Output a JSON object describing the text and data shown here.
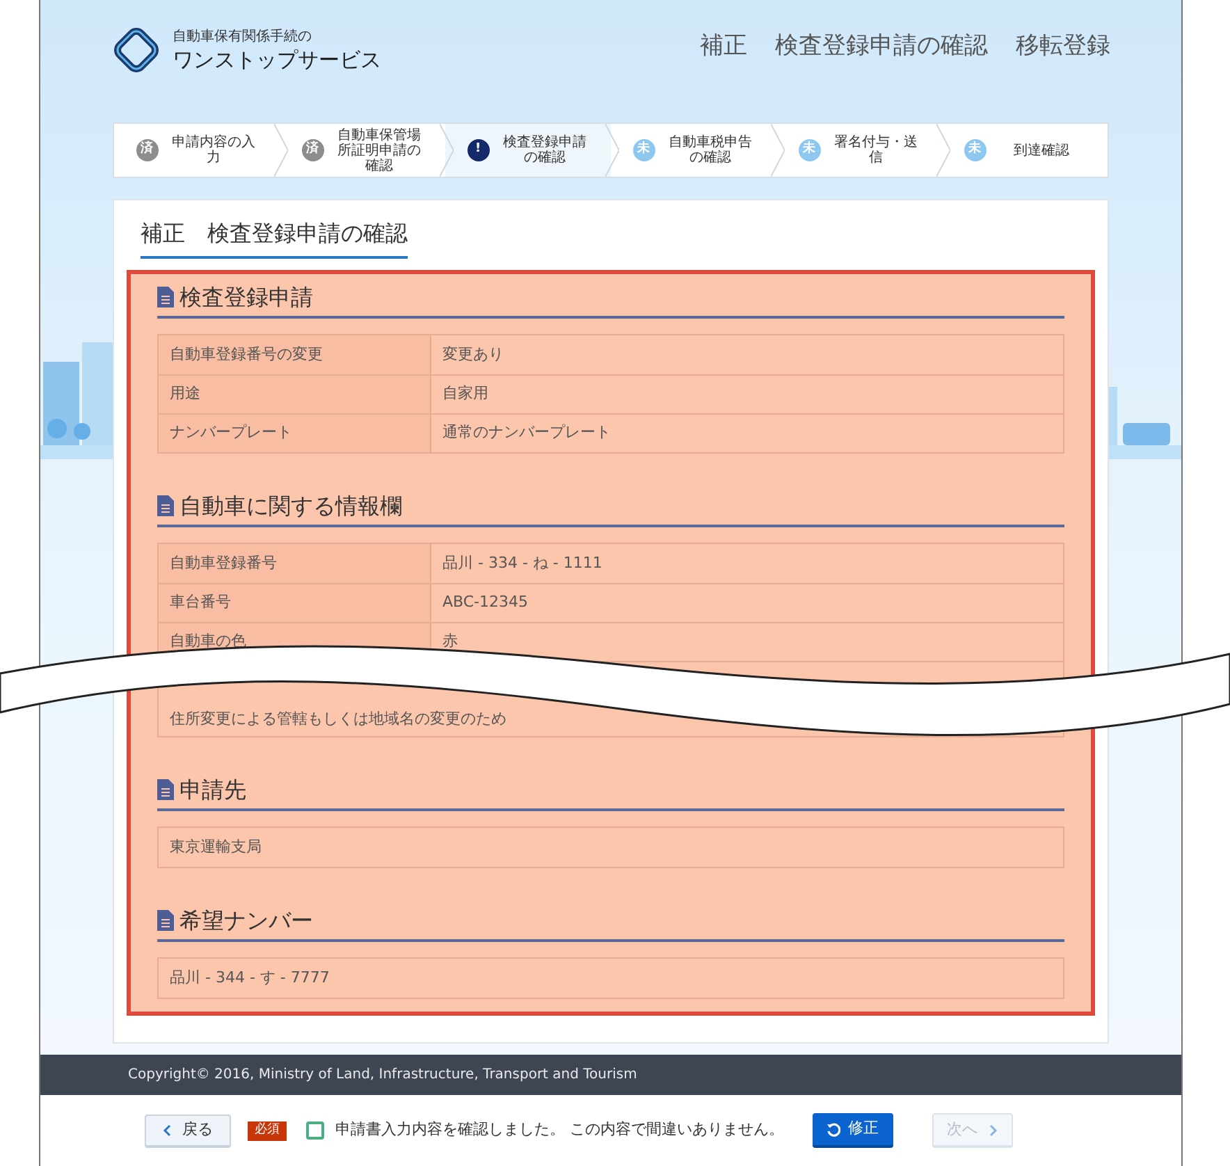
{
  "header": {
    "logo_small": "自動車保有関係手続の",
    "logo_main": "ワンストップサービス",
    "page_title": [
      "補正",
      "検査登録申請の確認",
      "移転登録"
    ]
  },
  "steps": [
    {
      "badge": "済",
      "label": "申請内容の入力",
      "kind": "done",
      "selected": false
    },
    {
      "badge": "済",
      "label": "自動車保管場所証明申請の確認",
      "kind": "done",
      "selected": false
    },
    {
      "badge": "!",
      "label": "検査登録申請の確認",
      "kind": "current",
      "selected": true
    },
    {
      "badge": "未",
      "label": "自動車税申告の確認",
      "kind": "todo",
      "selected": false
    },
    {
      "badge": "未",
      "label": "署名付与・送信",
      "kind": "todo",
      "selected": false
    },
    {
      "badge": "未",
      "label": "到達確認",
      "kind": "todo",
      "selected": false
    }
  ],
  "card_title": "補正　検査登録申請の確認",
  "sections": [
    {
      "title": "検査登録申請",
      "rows": [
        {
          "kind": "pair",
          "label": "自動車登録番号の変更",
          "value": "変更あり"
        },
        {
          "kind": "pair",
          "label": "用途",
          "value": "自家用"
        },
        {
          "kind": "pair",
          "label": "ナンバープレート",
          "value": "通常のナンバープレート"
        }
      ]
    },
    {
      "title": "自動車に関する情報欄",
      "rows": [
        {
          "kind": "pair",
          "label": "自動車登録番号",
          "value": "品川 - 334 - ね - 1111"
        },
        {
          "kind": "pair",
          "label": "車台番号",
          "value": "ABC-12345"
        },
        {
          "kind": "pair",
          "label": "自動車の色",
          "value": "赤"
        },
        {
          "kind": "torn",
          "value": "住所変更による管轄もしくは地域名の変更のため"
        }
      ]
    },
    {
      "title": "申請先",
      "rows": [
        {
          "kind": "single",
          "value": "東京運輸支局"
        }
      ]
    },
    {
      "title": "希望ナンバー",
      "rows": [
        {
          "kind": "single",
          "value": "品川 - 344 - す - 7777"
        }
      ]
    }
  ],
  "footer": {
    "copyright": "Copyright© 2016, Ministry of Land, Infrastructure, Transport and Tourism"
  },
  "actions": {
    "back": "戻る",
    "required_badge": "必須",
    "confirm": {
      "label": "申請書入力内容を確認しました。 この内容で間違いありません。",
      "checked": false
    },
    "fix": "修正",
    "next": {
      "label": "次へ",
      "disabled": true
    }
  }
}
